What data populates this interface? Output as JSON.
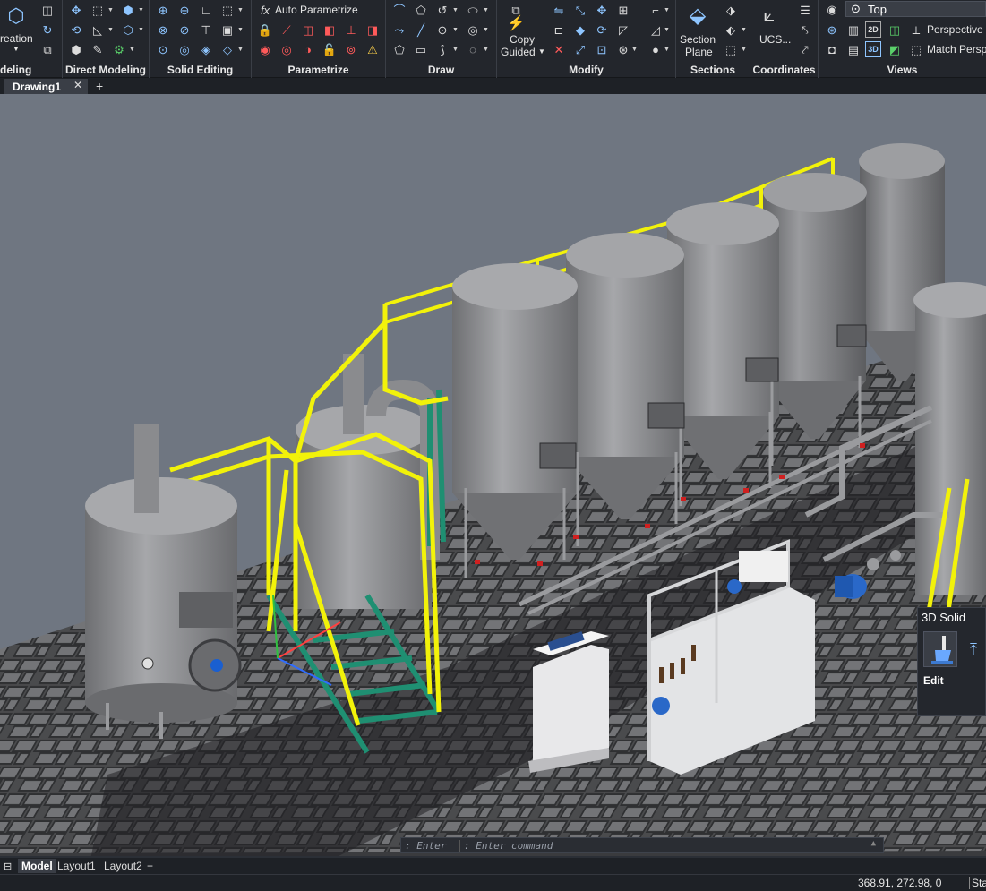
{
  "ribbon": {
    "panels": {
      "modeling": "deling",
      "direct_modeling": "Direct Modeling",
      "solid_editing": "Solid Editing",
      "parametrize": "Parametrize",
      "draw": "Draw",
      "modify": "Modify",
      "sections": "Sections",
      "coordinates": "Coordinates",
      "views": "Views"
    },
    "creation_label": "reation",
    "auto_parametrize": "Auto Parametrize",
    "copy_guided": [
      "Copy",
      "Guided"
    ],
    "section_plane": [
      "Section",
      "Plane"
    ],
    "ucs": "UCS...",
    "view_current": "Top",
    "perspective": "Perspective",
    "match_perspective": "Match Perspe"
  },
  "tabs": {
    "document": "Drawing1",
    "close": "✕",
    "add": "+"
  },
  "command": {
    "prefix": ": Enter",
    "placeholder": ": Enter command"
  },
  "quad": {
    "title": "3D Solid",
    "edit": "Edit"
  },
  "layouts": [
    "Model",
    "Layout1",
    "Layout2"
  ],
  "layout_add": "+",
  "status": {
    "coords": "368.91, 272.98, 0",
    "sta": "Sta"
  },
  "colors": {
    "viewport_bg": "#6f7681",
    "floor": "#4b4c4e",
    "railing": "#f2f20a",
    "stairs": "#1f8f72",
    "tank": "#8d8e91",
    "accent_icon": "#8ec5ff"
  }
}
